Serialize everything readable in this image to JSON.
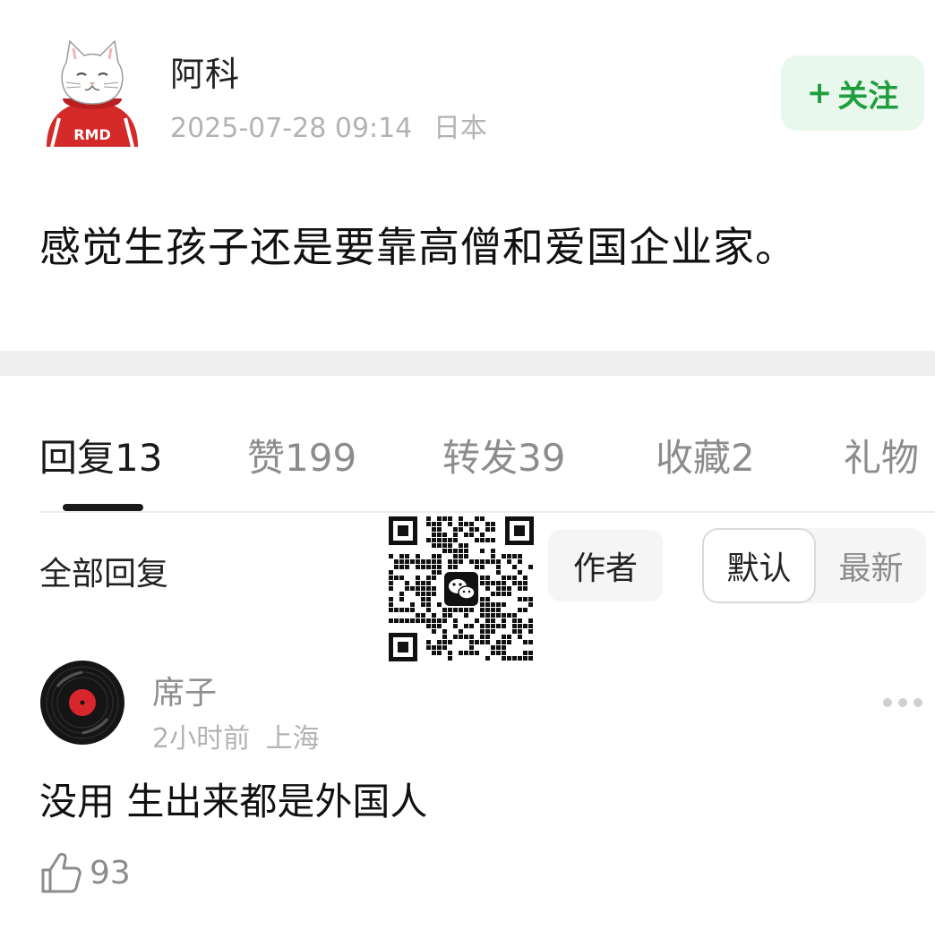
{
  "post": {
    "author": "阿科",
    "timestamp": "2025-07-28 09:14",
    "location": "日本",
    "follow_label": "关注",
    "follow_plus": "+",
    "avatar_badge": "RMD",
    "content": "感觉生孩子还是要靠高僧和爱国企业家。"
  },
  "tabs": [
    {
      "label": "回复",
      "count": "13",
      "active": true
    },
    {
      "label": "赞",
      "count": "199",
      "active": false
    },
    {
      "label": "转发",
      "count": "39",
      "active": false
    },
    {
      "label": "收藏",
      "count": "2",
      "active": false
    },
    {
      "label": "礼物",
      "count": "",
      "active": false
    }
  ],
  "filter": {
    "all_replies": "全部回复",
    "author_only": "作者",
    "sort_default": "默认",
    "sort_latest": "最新"
  },
  "reply": {
    "name": "席子",
    "time": "2小时前",
    "location": "上海",
    "text": "没用 生出来都是外国人",
    "likes": "93"
  },
  "colors": {
    "accent_green": "#1f9d3f",
    "follow_bg": "#e8f8ec",
    "muted_text": "#b3b3b3"
  },
  "icons": [
    "cat-avatar-icon",
    "vinyl-record-icon",
    "qr-code-icon",
    "wechat-icon",
    "more-dots-icon",
    "thumbs-up-icon"
  ]
}
